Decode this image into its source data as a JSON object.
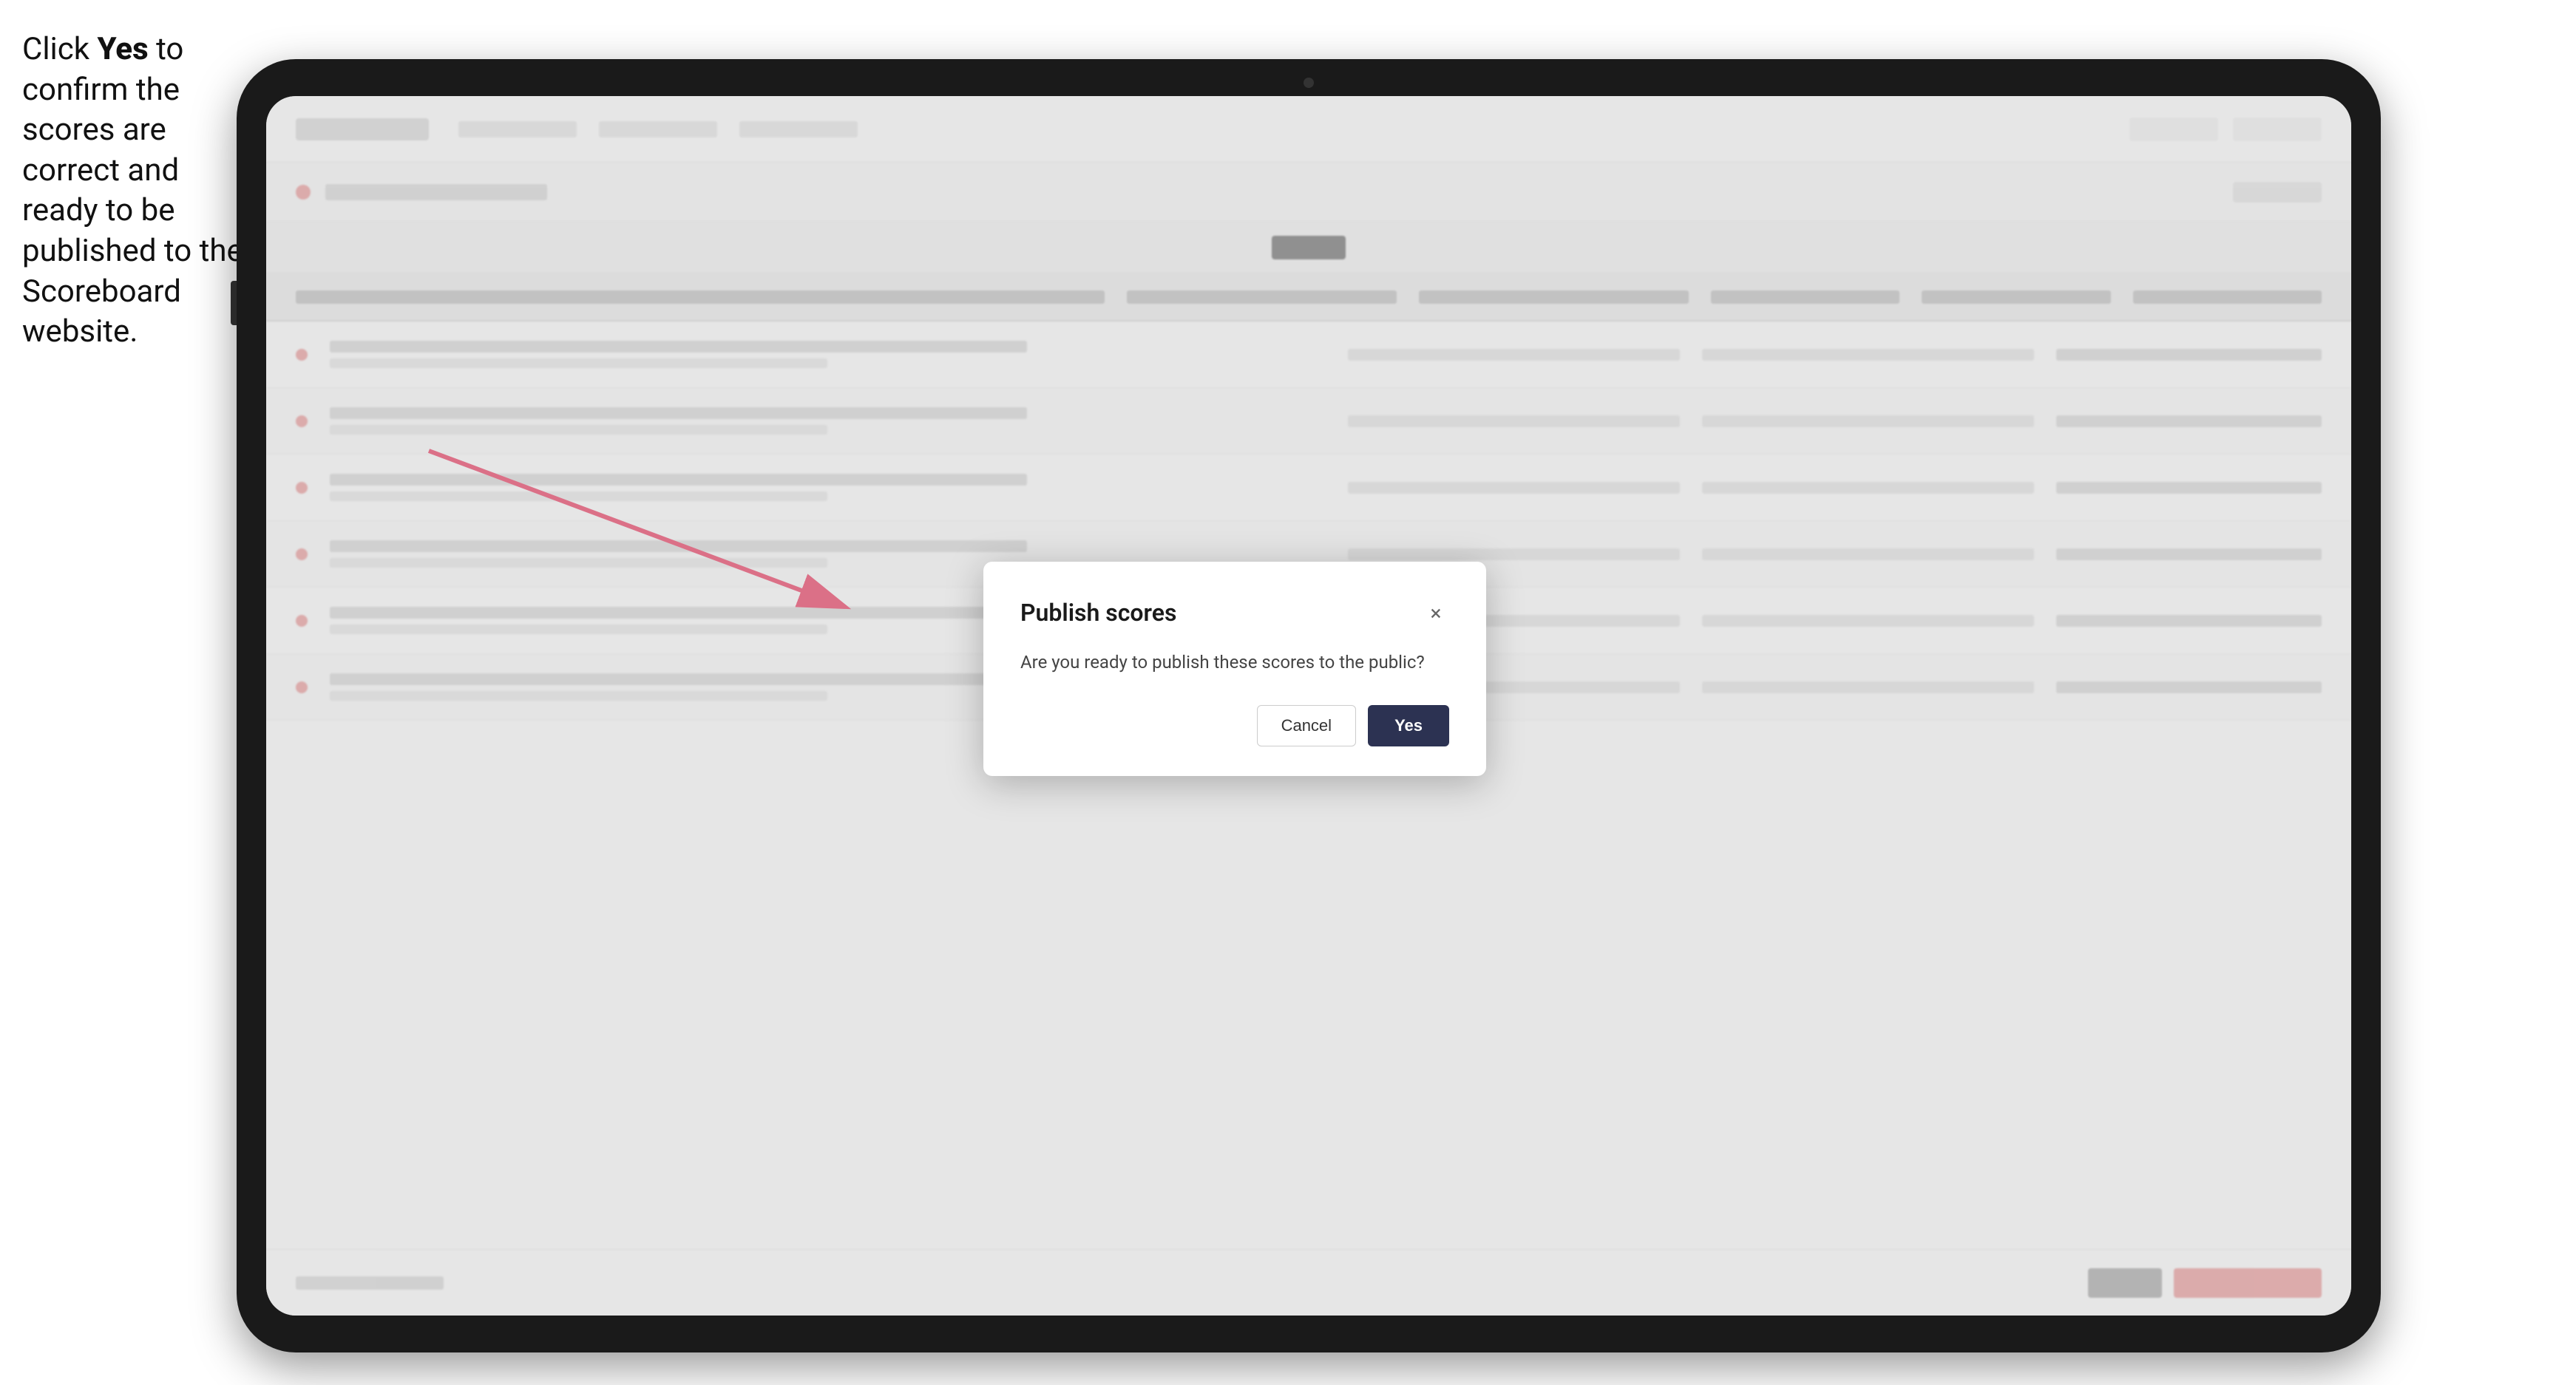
{
  "instruction": {
    "text_part1": "Click ",
    "bold": "Yes",
    "text_part2": " to confirm the scores are correct and ready to be published to the Scoreboard website."
  },
  "dialog": {
    "title": "Publish scores",
    "body": "Are you ready to publish these scores to the public?",
    "cancel_label": "Cancel",
    "yes_label": "Yes",
    "close_icon": "×"
  },
  "colors": {
    "yes_button_bg": "#2c3252",
    "arrow_color": "#e8365d"
  }
}
